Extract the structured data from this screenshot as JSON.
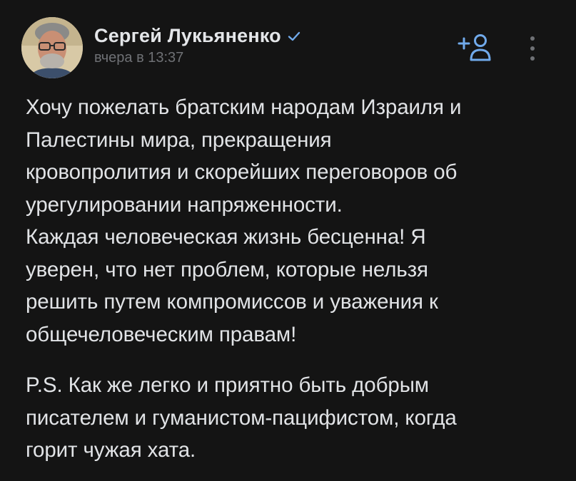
{
  "post": {
    "author_name": "Сергей Лукьяненко",
    "timestamp": "вчера в 13:37",
    "verified_icon": "checkmark-icon",
    "add_friend_icon": "add-friend-icon",
    "more_icon": "vertical-dots-icon",
    "accent_color": "#71aaeb",
    "paragraphs": {
      "p1_line1": "Хочу пожелать братским народам Израиля и",
      "p1_line2": "Палестины мира, прекращения",
      "p1_line3": "кровопролития и скорейших переговоров об",
      "p1_line4": "урегулировании напряженности.",
      "p2_line1": "Каждая человеческая жизнь бесценна! Я",
      "p2_line2": "уверен, что нет проблем, которые нельзя",
      "p2_line3": "решить путем компромиссов и уважения к",
      "p2_line4": "общечеловеческим правам!",
      "p3_line1": "P.S. Как же легко и приятно быть добрым",
      "p3_line2": "писателем и гуманистом-пацифистом, когда",
      "p3_line3": "горит чужая хата."
    }
  }
}
